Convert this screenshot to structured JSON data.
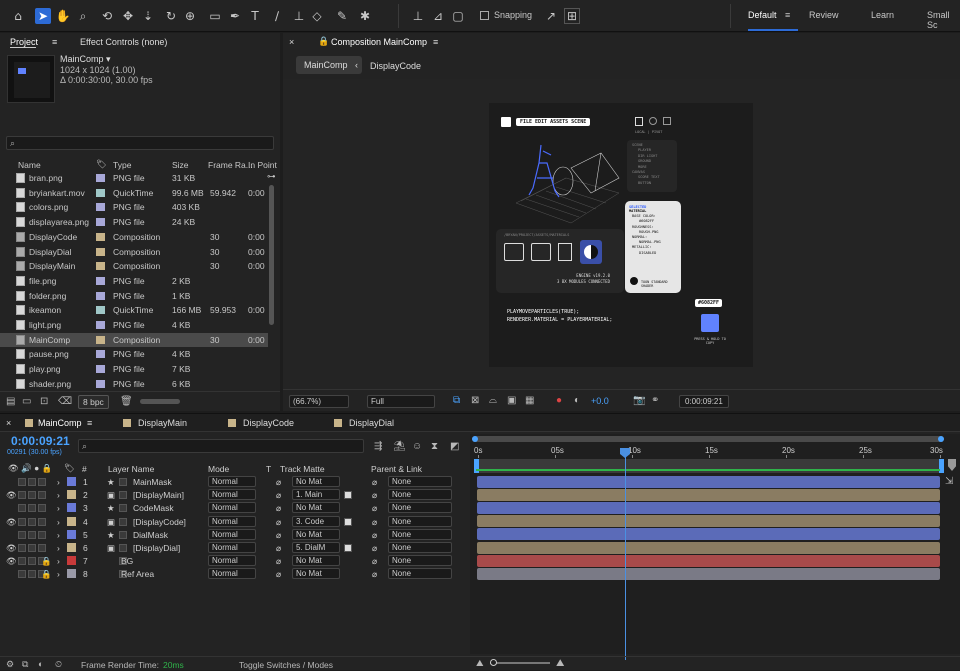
{
  "colors": {
    "accent": "#2d6bd6",
    "playhead": "#4a90e2",
    "timecode": "#4aa3ff",
    "selected_hex": "#6082FF",
    "audio_green": "#2fb34a"
  },
  "toolbar": {
    "tools": [
      "home-icon",
      "selection-arrow-icon",
      "hand-icon",
      "zoom-icon",
      "orbit-camera-icon",
      "pan-camera-icon",
      "dolly-camera-icon",
      "rotate-icon",
      "pan-behind-icon",
      "rectangle-icon",
      "pen-icon",
      "type-icon",
      "brush-icon",
      "clone-stamp-icon",
      "eraser-icon",
      "roto-brush-icon",
      "puppet-pin-icon"
    ],
    "snapping": "Snapping",
    "workspaces": [
      "Default",
      "Review",
      "Learn",
      "Small Sc"
    ]
  },
  "project": {
    "tab": "Project",
    "effect_controls": "Effect Controls (none)",
    "comp_name": "MainComp ▾",
    "comp_dims": "1024 x 1024 (1.00)",
    "comp_dur": "Δ 0:00:30:00, 30.00 fps",
    "search_placeholder": "",
    "headers": {
      "name": "Name",
      "type": "Type",
      "size": "Size",
      "fps": "Frame Ra...",
      "in": "In Point"
    },
    "items": [
      {
        "name": "bran.png",
        "type": "PNG file",
        "size": "31 KB",
        "fps": "",
        "in": "",
        "kind": "png",
        "color": "#a8a8d8"
      },
      {
        "name": "bryiankart.mov",
        "type": "QuickTime",
        "size": "99.6 MB",
        "fps": "59.942",
        "in": "0:00",
        "kind": "mov",
        "color": "#a0c8c8"
      },
      {
        "name": "colors.png",
        "type": "PNG file",
        "size": "403 KB",
        "fps": "",
        "in": "",
        "kind": "png",
        "color": "#a8a8d8"
      },
      {
        "name": "displayarea.png",
        "type": "PNG file",
        "size": "24 KB",
        "fps": "",
        "in": "",
        "kind": "png",
        "color": "#a8a8d8"
      },
      {
        "name": "DisplayCode",
        "type": "Composition",
        "size": "",
        "fps": "30",
        "in": "0:00",
        "kind": "comp",
        "color": "#c8b48a"
      },
      {
        "name": "DisplayDial",
        "type": "Composition",
        "size": "",
        "fps": "30",
        "in": "0:00",
        "kind": "comp",
        "color": "#c8b48a"
      },
      {
        "name": "DisplayMain",
        "type": "Composition",
        "size": "",
        "fps": "30",
        "in": "0:00",
        "kind": "comp",
        "color": "#c8b48a"
      },
      {
        "name": "file.png",
        "type": "PNG file",
        "size": "2 KB",
        "fps": "",
        "in": "",
        "kind": "png",
        "color": "#a8a8d8"
      },
      {
        "name": "folder.png",
        "type": "PNG file",
        "size": "1 KB",
        "fps": "",
        "in": "",
        "kind": "png",
        "color": "#a8a8d8"
      },
      {
        "name": "ikeamon",
        "type": "QuickTime",
        "size": "166 MB",
        "fps": "59.953",
        "in": "0:00",
        "kind": "mov",
        "color": "#a0c8c8"
      },
      {
        "name": "light.png",
        "type": "PNG file",
        "size": "4 KB",
        "fps": "",
        "in": "",
        "kind": "png",
        "color": "#a8a8d8"
      },
      {
        "name": "MainComp",
        "type": "Composition",
        "size": "",
        "fps": "30",
        "in": "0:00",
        "kind": "comp",
        "color": "#c8b48a"
      },
      {
        "name": "pause.png",
        "type": "PNG file",
        "size": "4 KB",
        "fps": "",
        "in": "",
        "kind": "png",
        "color": "#a8a8d8"
      },
      {
        "name": "play.png",
        "type": "PNG file",
        "size": "7 KB",
        "fps": "",
        "in": "",
        "kind": "png",
        "color": "#a8a8d8"
      },
      {
        "name": "shader.png",
        "type": "PNG file",
        "size": "6 KB",
        "fps": "",
        "in": "",
        "kind": "png",
        "color": "#a8a8d8"
      }
    ],
    "bpc": "8 bpc"
  },
  "composition": {
    "tab": "Composition MainComp",
    "crumbs": [
      "MainComp",
      "DisplayCode"
    ],
    "zoom": "(66.7%)",
    "resolution": "Full",
    "exposure": "+0.0",
    "timecode": "0:00:09:21",
    "canvas": {
      "menu": "FILE EDIT ASSETS SCENE",
      "local_pivot": "LOCAL | PIVOT",
      "scene_list": [
        "SCENE",
        "PLAYER",
        "DIR LIGHT",
        "GROUND",
        "MORE",
        "CANVAS",
        "SCORE TEXT",
        "BUTTON"
      ],
      "selected_title": "SELECTED",
      "selected_lines": [
        "MATERIAL",
        "BASE COLOR:",
        "#6082FF",
        "ROUGHNESS:",
        "ROUGH.PNG",
        "NORMAL:",
        "NORMAL.PNG",
        "METALLIC:",
        "DISABLED"
      ],
      "shader_label": "TOON STANDARD SHADER",
      "path": "/BRYAN/PROJECT/ASSETS/MATERIALS",
      "engine": "ENGINE v19.2.0",
      "modules": "3 BX MODULES CONNECTED",
      "code1": "PLAYMOVEPARTICLES(TRUE);",
      "code2": "RENDERER.MATERIAL = PLAYERMATERIAL;",
      "hex_badge": "#6082FF",
      "press_hold": "PRESS & HOLD TO COPY"
    }
  },
  "timeline": {
    "tabs": [
      "MainComp",
      "DisplayMain",
      "DisplayCode",
      "DisplayDial"
    ],
    "timecode": "0:00:09:21",
    "frames": "00291 (30.00 fps)",
    "headers": {
      "num": "#",
      "layer": "Layer Name",
      "mode": "Mode",
      "t": "T",
      "matte": "Track Matte",
      "parent": "Parent & Link"
    },
    "ruler": [
      "0s",
      "05s",
      "10s",
      "15s",
      "20s",
      "25s",
      "30s"
    ],
    "layers": [
      {
        "n": "1",
        "name": "MainMask",
        "mode": "Normal",
        "matte": "No Mat",
        "parent": "None",
        "color": "#6a7ad8",
        "bar": "#5b6bb8",
        "star": true,
        "eye": false
      },
      {
        "n": "2",
        "name": "[DisplayMain]",
        "mode": "Normal",
        "matte": "1. Main",
        "parent": "None",
        "color": "#c8b48a",
        "bar": "#8a7c62",
        "star": false,
        "eye": true
      },
      {
        "n": "3",
        "name": "CodeMask",
        "mode": "Normal",
        "matte": "No Mat",
        "parent": "None",
        "color": "#6a7ad8",
        "bar": "#5b6bb8",
        "star": true,
        "eye": false
      },
      {
        "n": "4",
        "name": "[DisplayCode]",
        "mode": "Normal",
        "matte": "3. Code",
        "parent": "None",
        "color": "#c8b48a",
        "bar": "#8a7c62",
        "star": false,
        "eye": true
      },
      {
        "n": "5",
        "name": "DialMask",
        "mode": "Normal",
        "matte": "No Mat",
        "parent": "None",
        "color": "#6a7ad8",
        "bar": "#5b6bb8",
        "star": true,
        "eye": false
      },
      {
        "n": "6",
        "name": "[DisplayDial]",
        "mode": "Normal",
        "matte": "5. DialM",
        "parent": "None",
        "color": "#c8b48a",
        "bar": "#8a7c62",
        "star": false,
        "eye": true
      },
      {
        "n": "7",
        "name": "BG",
        "mode": "Normal",
        "matte": "No Mat",
        "parent": "None",
        "color": "#c83a3a",
        "bar": "#a84a4a",
        "star": false,
        "eye": true
      },
      {
        "n": "8",
        "name": "Ref Area",
        "mode": "Normal",
        "matte": "No Mat",
        "parent": "None",
        "color": "#9a9aa8",
        "bar": "#7a7a86",
        "star": false,
        "eye": false
      }
    ],
    "render_label": "Frame Render Time:",
    "render_value": "20ms",
    "toggle": "Toggle Switches / Modes"
  }
}
